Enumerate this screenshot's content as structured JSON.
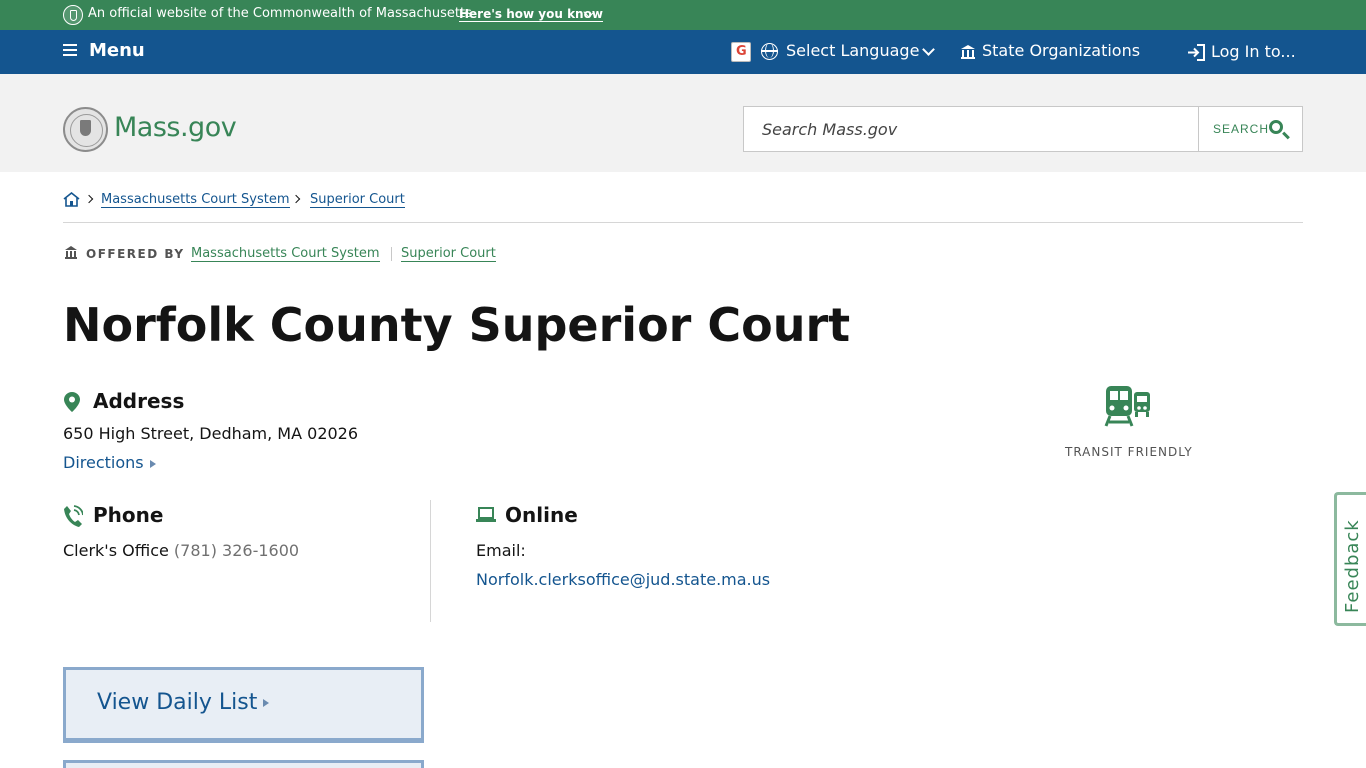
{
  "official_bar": {
    "text": "An official website of the Commonwealth of Massachusetts",
    "how_link": "Here's how you know"
  },
  "nav": {
    "menu_label": "Menu",
    "language_label": "Select Language",
    "state_orgs_label": "State Organizations",
    "login_label": "Log In to..."
  },
  "header": {
    "logo_text": "Mass.gov",
    "search_placeholder": "Search Mass.gov",
    "search_button_label": "SEARCH"
  },
  "breadcrumb": {
    "items": [
      "Massachusetts Court System",
      "Superior Court"
    ]
  },
  "offered_by": {
    "label": "OFFERED BY",
    "orgs": [
      "Massachusetts Court System",
      "Superior Court"
    ]
  },
  "page": {
    "title": "Norfolk County Superior Court"
  },
  "address": {
    "title": "Address",
    "line": "650 High Street, Dedham, MA 02026",
    "directions_label": "Directions"
  },
  "transit": {
    "label": "TRANSIT FRIENDLY"
  },
  "phone": {
    "title": "Phone",
    "office_label": "Clerk's Office",
    "number": "(781) 326-1600"
  },
  "online": {
    "title": "Online",
    "email_label": "Email:",
    "email": "Norfolk.clerksoffice@jud.state.ma.us"
  },
  "actions": {
    "daily_list_label": "View Daily List"
  },
  "feedback": {
    "label": "Feedback"
  },
  "colors": {
    "green": "#388557",
    "blue": "#14558f",
    "header_bg": "#f2f2f2"
  }
}
